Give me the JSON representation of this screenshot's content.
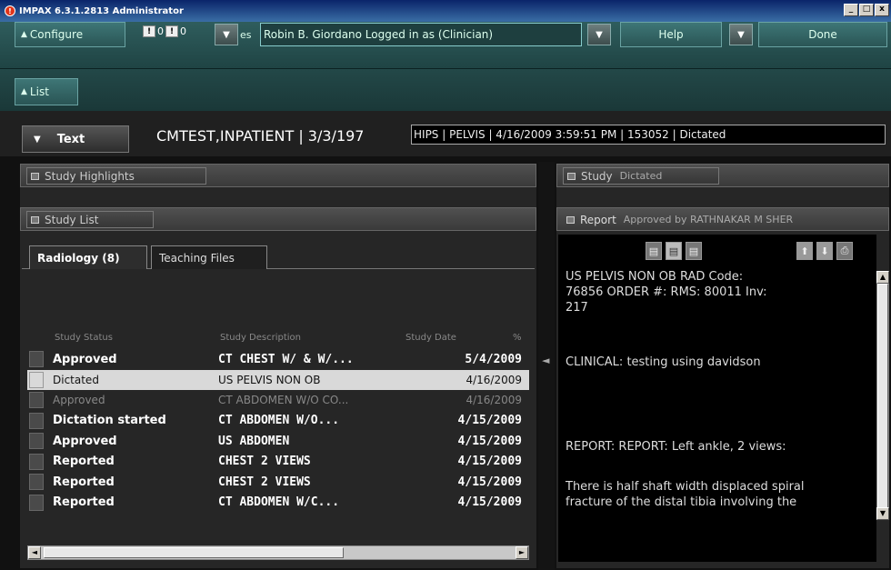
{
  "window": {
    "title": "IMPAX 6.3.1.2813 Administrator",
    "min_label": "_",
    "max_label": "□",
    "close_label": "x"
  },
  "toolbar": {
    "configure_label": "Configure",
    "alert_count_1": "0",
    "alert_count_2": "0",
    "alert_suffix": "es",
    "user_status": "Robin  B. Giordano Logged in as (Clinician)",
    "help_label": "Help",
    "done_label": "Done",
    "list_label": "List"
  },
  "patient": {
    "text_button_label": "Text",
    "name_dob": "CMTEST,INPATIENT  | 3/3/197",
    "study_info": "HIPS | PELVIS | 4/16/2009 3:59:51 PM | 153052 | Dictated"
  },
  "left": {
    "highlights_label": "Study Highlights",
    "study_list_label": "Study List",
    "tabs": [
      "Radiology (8)",
      "Teaching Files"
    ],
    "columns": [
      "Study Status",
      "Study Description",
      "Study Date",
      "%"
    ],
    "rows": [
      {
        "status": "Approved",
        "desc": "CT CHEST W/ & W/...",
        "date": "5/4/2009",
        "style": "bold"
      },
      {
        "status": "Dictated",
        "desc": "US PELVIS NON OB",
        "date": "4/16/2009",
        "style": "sel"
      },
      {
        "status": "Approved",
        "desc": "CT ABDOMEN W/O CO...",
        "date": "4/16/2009",
        "style": "dim"
      },
      {
        "status": "Dictation started",
        "desc": "CT ABDOMEN W/O...",
        "date": "4/15/2009",
        "style": "bold"
      },
      {
        "status": "Approved",
        "desc": "US ABDOMEN",
        "date": "4/15/2009",
        "style": "bold"
      },
      {
        "status": "Reported",
        "desc": "CHEST 2 VIEWS",
        "date": "4/15/2009",
        "style": "bold"
      },
      {
        "status": "Reported",
        "desc": "CHEST 2 VIEWS",
        "date": "4/15/2009",
        "style": "bold"
      },
      {
        "status": "Reported",
        "desc": "CT ABDOMEN W/C...",
        "date": "4/15/2009",
        "style": "bold"
      }
    ]
  },
  "right": {
    "study_label": "Study",
    "study_status": "Dictated",
    "report_label": "Report",
    "report_status": "Approved by RATHNAKAR M SHER",
    "report_line1": "US PELVIS NON OB    RAD Code:",
    "report_line2": "76856    ORDER #: RMS: 80011    Inv:",
    "report_line3": "217",
    "clinical": "CLINICAL: testing using davidson",
    "report_heading": "REPORT:  REPORT:  Left ankle, 2 views:",
    "finding_line1": "There is half shaft width displaced spiral",
    "finding_line2": "fracture of the distal tibia  involving the"
  }
}
